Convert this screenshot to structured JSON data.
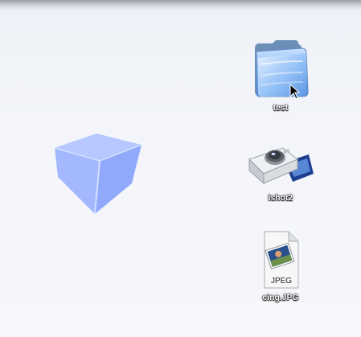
{
  "desktop": {
    "background_color": "#f3f5fa",
    "icons": [
      {
        "label": "test",
        "icon": "folder-icon"
      },
      {
        "label": "ishot2",
        "icon": "camera-icon"
      },
      {
        "label": "cing.JPG",
        "icon": "jpeg-file-icon",
        "badge": "JPEG"
      }
    ],
    "cube_color": "#9fb6ff"
  }
}
